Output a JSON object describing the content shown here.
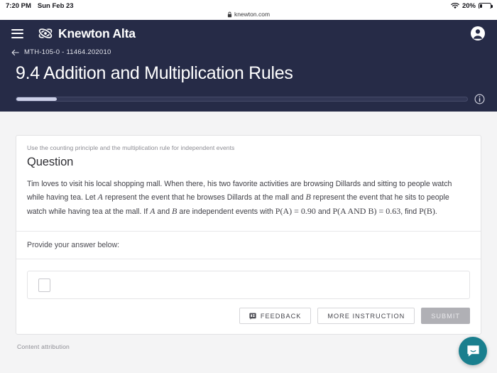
{
  "status_bar": {
    "time": "7:20 PM",
    "date": "Sun Feb 23",
    "battery_percent": "20%",
    "wifi_icon": "wifi-icon",
    "battery_icon": "battery-icon"
  },
  "browser": {
    "url": "knewton.com",
    "lock_icon": "lock-icon"
  },
  "header": {
    "menu_icon": "hamburger-menu-icon",
    "logo_icon": "knewton-atom-logo-icon",
    "brand": "Knewton Alta",
    "account_icon": "account-avatar-icon",
    "back_icon": "back-arrow-icon",
    "breadcrumb": "MTH-105-0 - 11464.202010",
    "title": "9.4 Addition and Multiplication Rules",
    "progress_percent": 9,
    "info_icon": "info-circle-icon"
  },
  "card": {
    "objective": "Use the counting principle and the multiplication rule for independent events",
    "heading": "Question",
    "question_paragraph": "Tim loves to visit his local shopping mall. When there, his two favorite activities are browsing Dillards and sitting to people watch while having tea. Let A represent the event that he browses Dillards at the mall and B represent the event that he sits to people watch while having tea at the mall. If A and B are independent events with P(A) = 0.90 and P(A AND B) = 0.63, find P(B).",
    "q_text_1": "Tim loves to visit his local shopping mall. When there, his two favorite activities are browsing Dillards and sitting to people watch while having tea. Let ",
    "q_var_a": "A",
    "q_text_2": " represent the event that he browses Dillards at the mall and ",
    "q_var_b": "B",
    "q_text_3": " represent the event that he sits to people watch while having tea at the mall. If ",
    "q_var_a2": "A",
    "q_text_4": " and ",
    "q_var_b2": "B",
    "q_text_5": " are independent events with ",
    "q_eq_1": "P(A) = 0.90",
    "q_text_6": " and ",
    "q_eq_2": "P(A AND B) = 0.63",
    "q_text_7": ", find ",
    "q_eq_3": "P(B)",
    "q_text_8": ".",
    "provide_label": "Provide your answer below:",
    "answer_value": "",
    "answer_placeholder_icon": "math-input-placeholder-box"
  },
  "actions": {
    "feedback_icon": "feedback-flag-icon",
    "feedback_label": "FEEDBACK",
    "more_instruction_label": "MORE INSTRUCTION",
    "submit_label": "SUBMIT"
  },
  "footer": {
    "attribution": "Content attribution"
  },
  "chat": {
    "icon": "intercom-chat-smile-icon"
  },
  "colors": {
    "header_navy": "#262b47",
    "progress_fill": "#ccd0e8",
    "chat_teal": "#1a7f8e",
    "submit_disabled": "#b0b0b5",
    "page_bg": "#f4f4f5"
  }
}
